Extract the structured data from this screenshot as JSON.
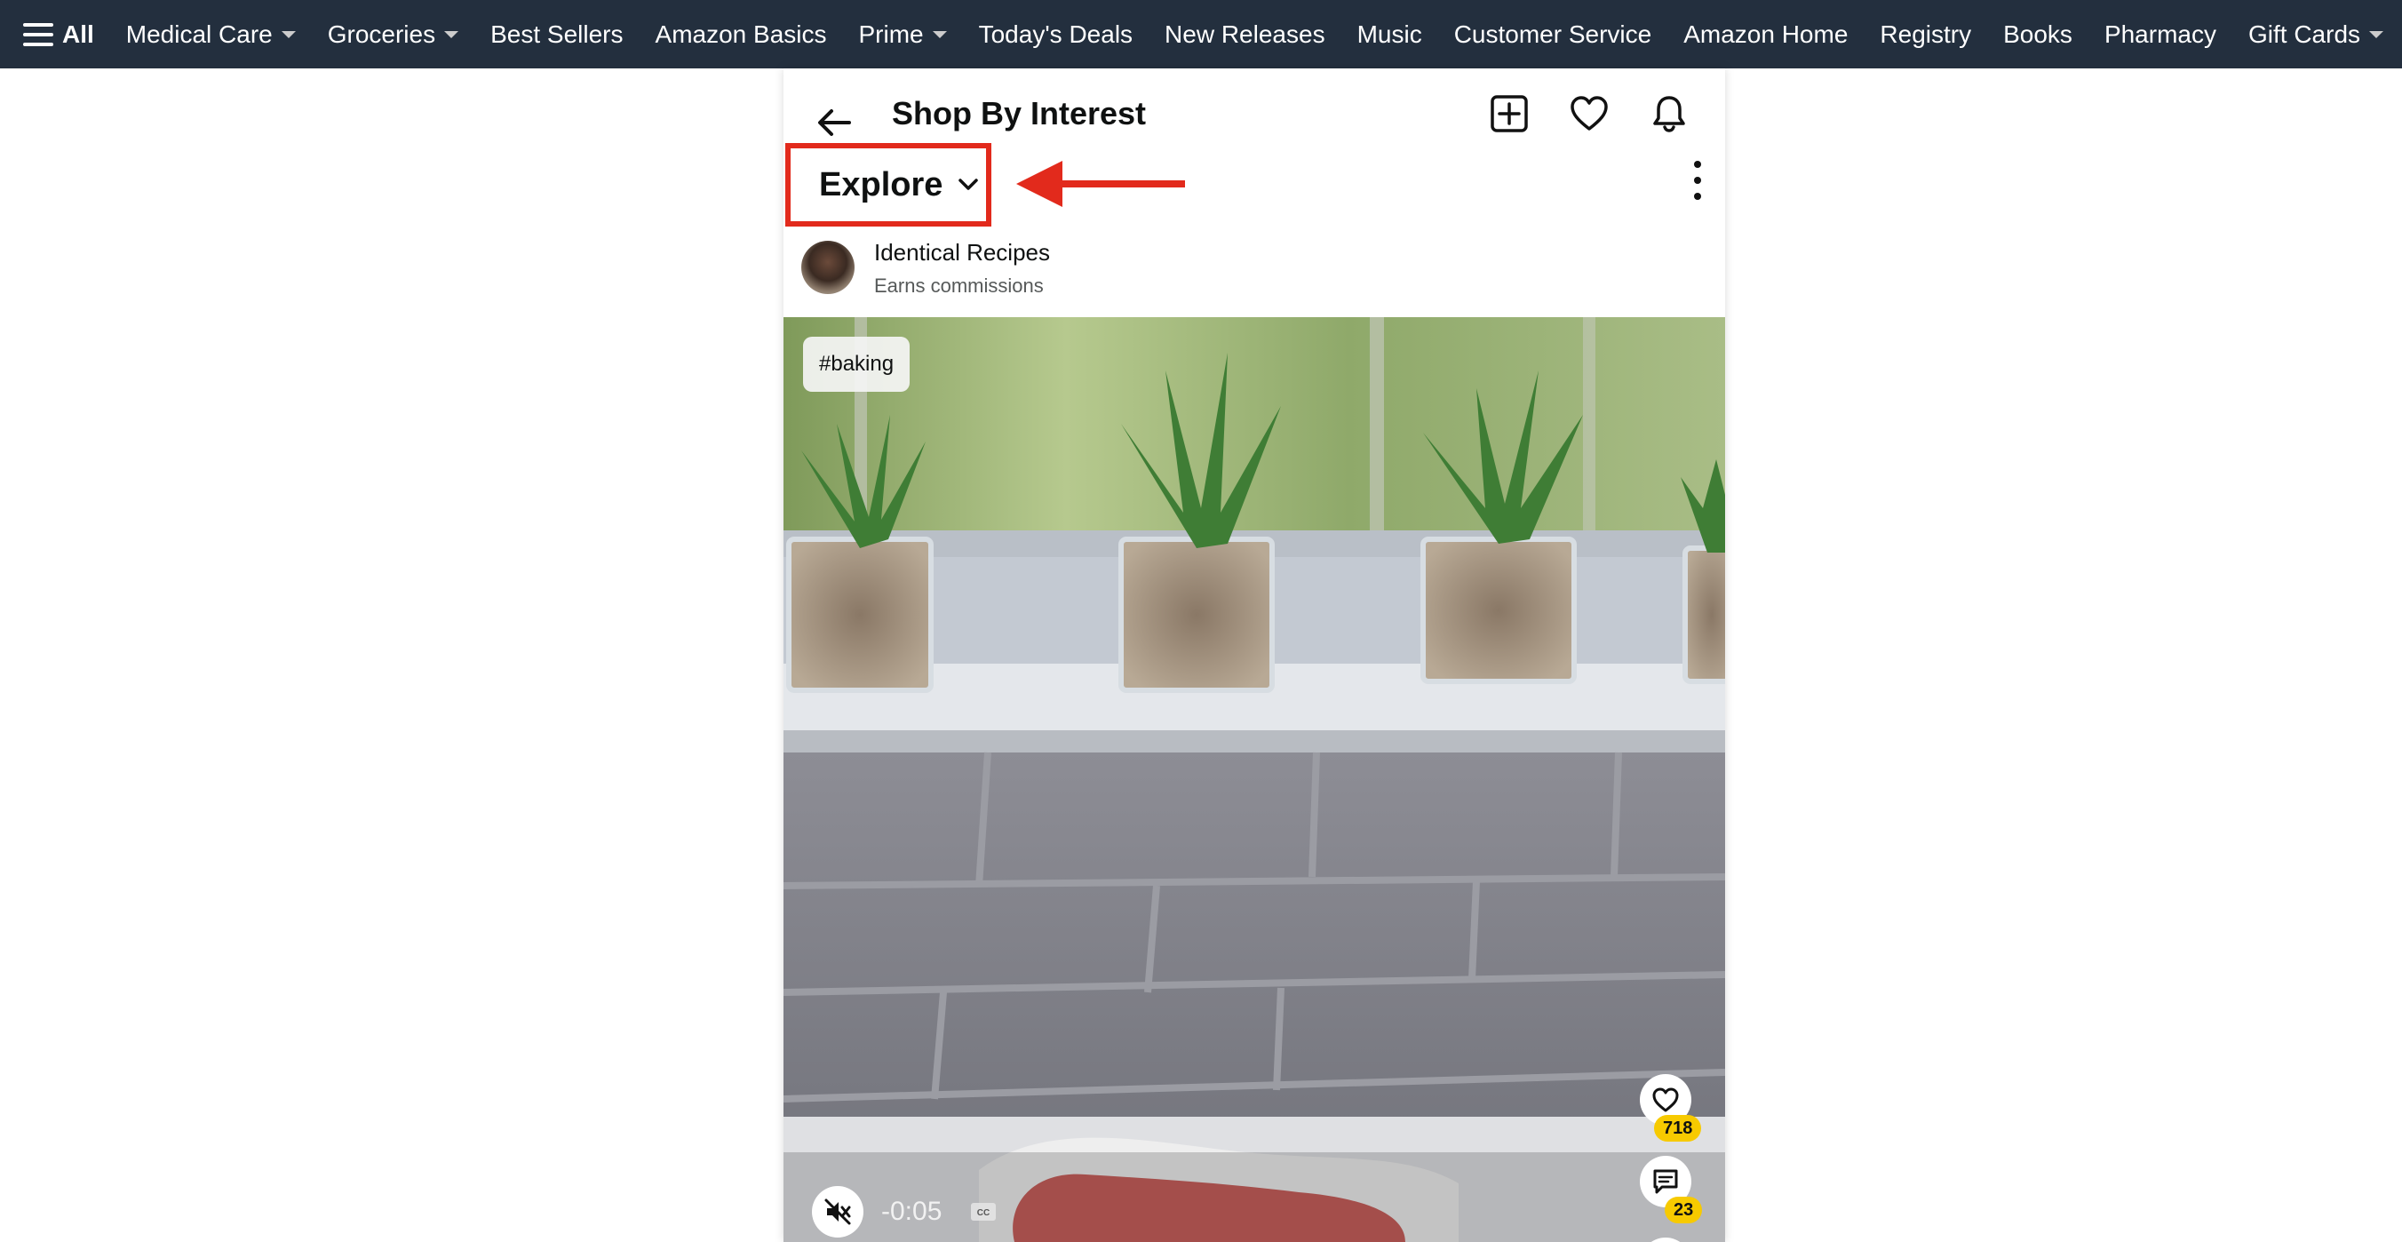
{
  "topnav": {
    "all_label": "All",
    "items": [
      {
        "label": "Medical Care",
        "dropdown": true
      },
      {
        "label": "Groceries",
        "dropdown": true
      },
      {
        "label": "Best Sellers",
        "dropdown": false
      },
      {
        "label": "Amazon Basics",
        "dropdown": false
      },
      {
        "label": "Prime",
        "dropdown": true
      },
      {
        "label": "Today's Deals",
        "dropdown": false
      },
      {
        "label": "New Releases",
        "dropdown": false
      },
      {
        "label": "Music",
        "dropdown": false
      },
      {
        "label": "Customer Service",
        "dropdown": false
      },
      {
        "label": "Amazon Home",
        "dropdown": false
      },
      {
        "label": "Registry",
        "dropdown": false
      },
      {
        "label": "Books",
        "dropdown": false
      },
      {
        "label": "Pharmacy",
        "dropdown": false
      },
      {
        "label": "Gift Cards",
        "dropdown": true
      }
    ]
  },
  "header": {
    "title": "Shop By Interest",
    "icons": [
      "back-arrow-icon",
      "add-post-icon",
      "favorites-heart-icon",
      "notifications-bell-icon"
    ]
  },
  "explore": {
    "label": "Explore",
    "highlight_color": "#e22a1c"
  },
  "post": {
    "author": "Identical Recipes",
    "subtitle": "Earns commissions",
    "tag": "#baking",
    "likes": "718",
    "comments": "23",
    "time_remaining": "-0:05"
  },
  "colors": {
    "nav_background": "#232f3e",
    "badge": "#f7ca00",
    "annotation_red": "#e22a1c"
  }
}
